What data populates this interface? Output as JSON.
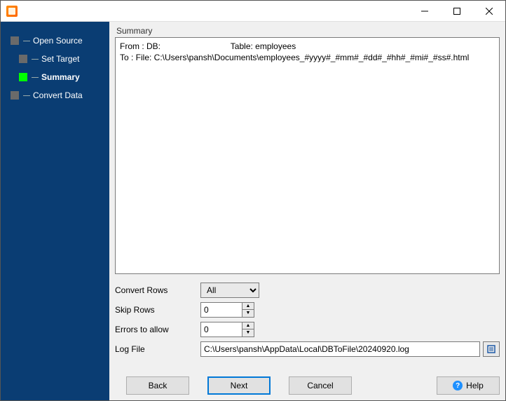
{
  "sidebar": {
    "items": [
      {
        "label": "Open Source"
      },
      {
        "label": "Set Target"
      },
      {
        "label": "Summary"
      },
      {
        "label": "Convert Data"
      }
    ]
  },
  "main": {
    "panel_title": "Summary",
    "summary_lines": {
      "from": "From : DB:                              Table: employees",
      "to": "To : File: C:\\Users\\pansh\\Documents\\employees_#yyyy#_#mm#_#dd#_#hh#_#mi#_#ss#.html"
    },
    "form": {
      "convert_rows_label": "Convert Rows",
      "convert_rows_value": "All",
      "skip_rows_label": "Skip Rows",
      "skip_rows_value": "0",
      "errors_label": "Errors to allow",
      "errors_value": "0",
      "logfile_label": "Log File",
      "logfile_value": "C:\\Users\\pansh\\AppData\\Local\\DBToFile\\20240920.log"
    },
    "buttons": {
      "back": "Back",
      "next": "Next",
      "cancel": "Cancel",
      "help": "Help"
    }
  }
}
